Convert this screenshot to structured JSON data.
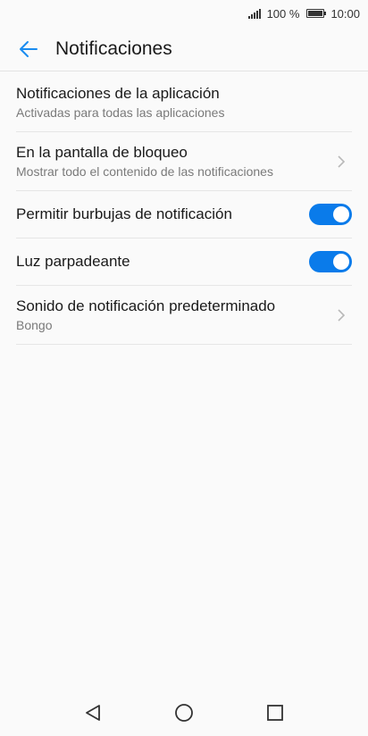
{
  "status_bar": {
    "battery_text": "100 %",
    "time": "10:00"
  },
  "app_bar": {
    "title": "Notificaciones",
    "back_icon": "arrow-left-icon",
    "accent_color": "#1a8cf0"
  },
  "settings": [
    {
      "title": "Notificaciones de la aplicación",
      "subtitle": "Activadas para todas las aplicaciones",
      "control": "none"
    },
    {
      "title": "En la pantalla de bloqueo",
      "subtitle": "Mostrar todo el contenido de las notificaciones",
      "control": "chevron"
    },
    {
      "title": "Permitir burbujas de notificación",
      "control": "toggle",
      "enabled": true
    },
    {
      "title": "Luz parpadeante",
      "control": "toggle",
      "enabled": true
    },
    {
      "title": "Sonido de notificación predeterminado",
      "subtitle": "Bongo",
      "control": "chevron"
    }
  ],
  "toggle_color": "#0a7bea",
  "nav_bar": {
    "icons": [
      "back-triangle-icon",
      "home-circle-icon",
      "recents-square-icon"
    ]
  }
}
